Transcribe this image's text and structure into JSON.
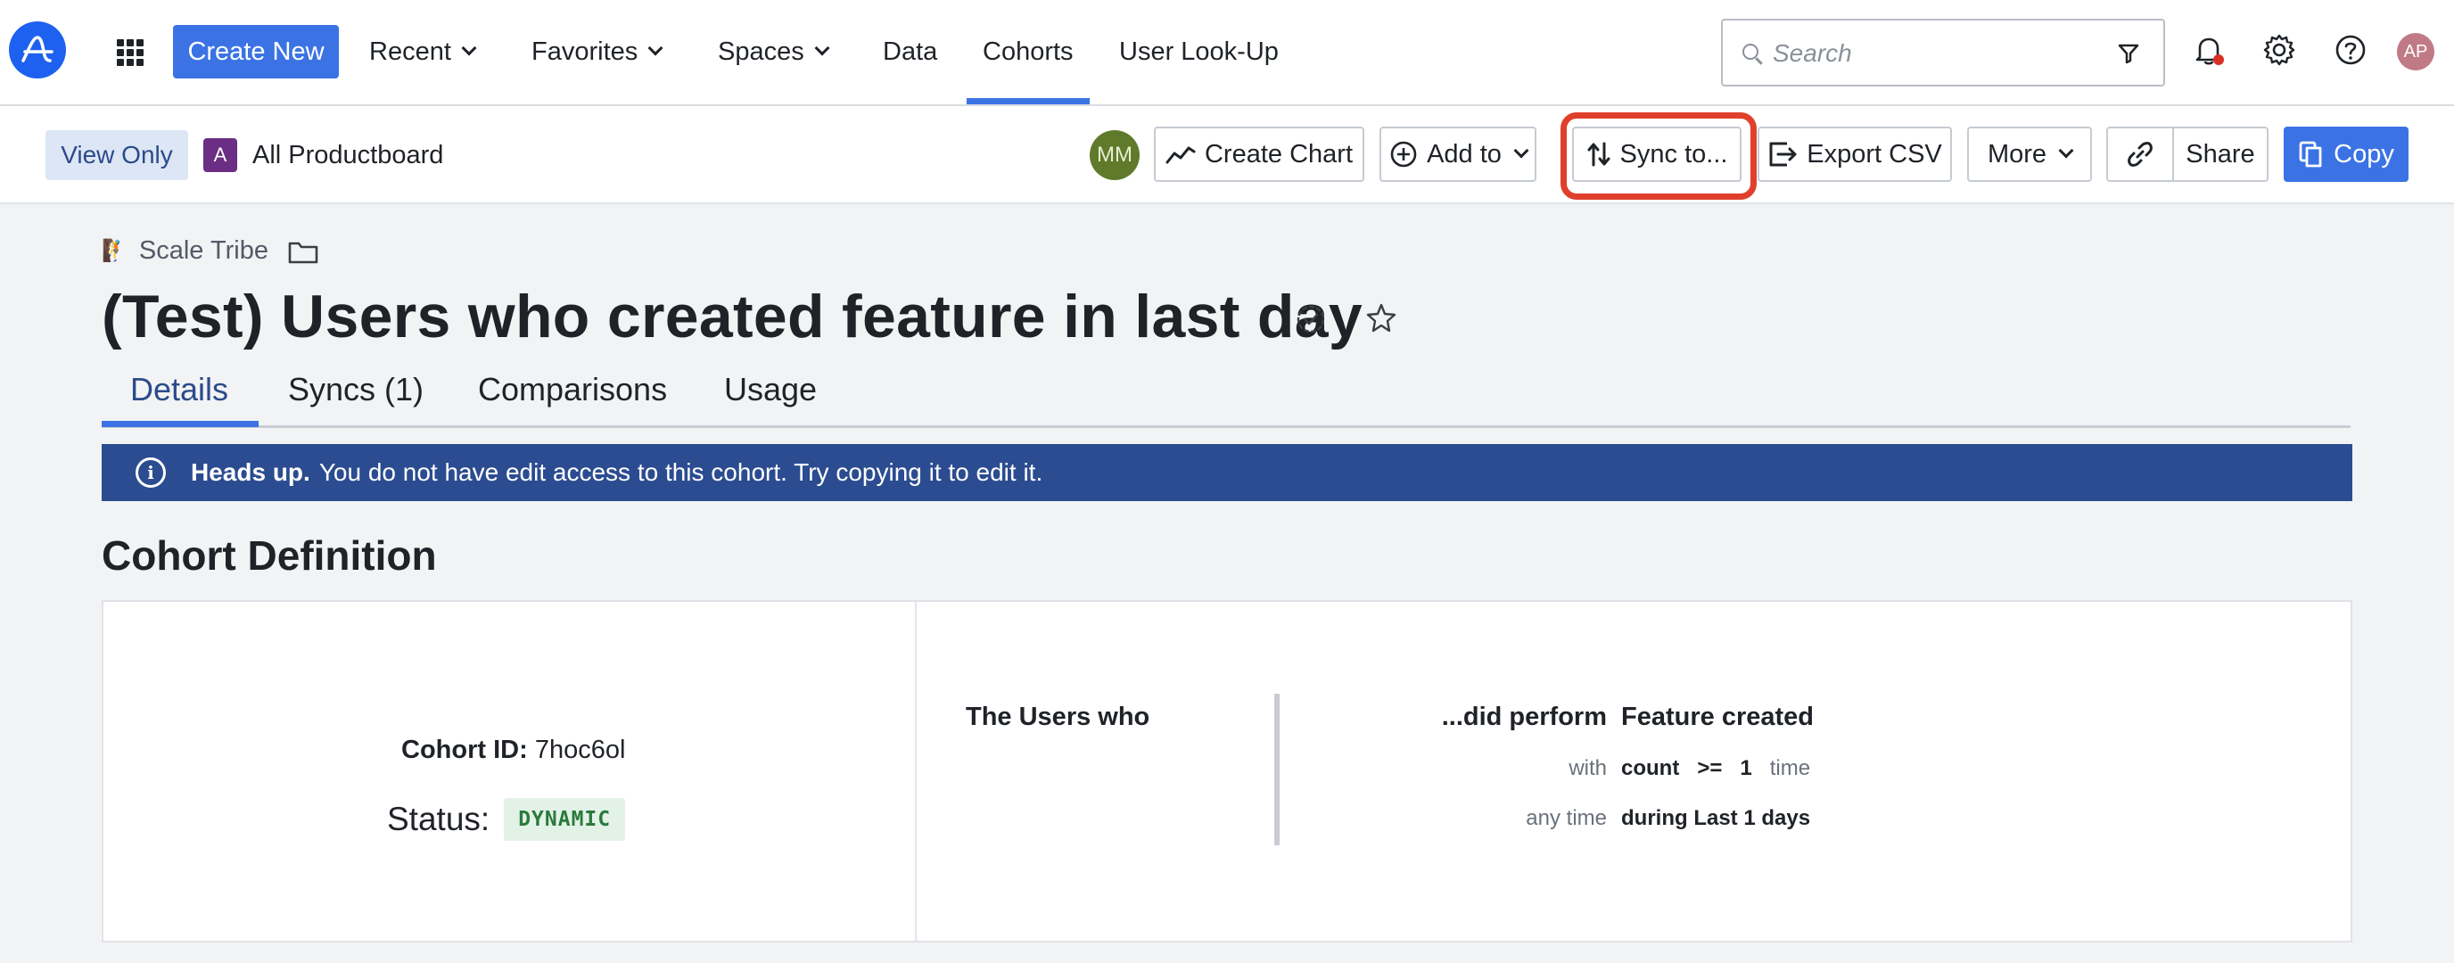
{
  "topnav": {
    "logo_icon": "amplitude-logo-icon",
    "apps_icon": "apps-grid-icon",
    "create_new": "Create New",
    "items": [
      {
        "label": "Recent",
        "dropdown": true
      },
      {
        "label": "Favorites",
        "dropdown": true
      },
      {
        "label": "Spaces",
        "dropdown": true
      },
      {
        "label": "Data",
        "dropdown": false
      },
      {
        "label": "Cohorts",
        "dropdown": false,
        "active": true
      },
      {
        "label": "User Look-Up",
        "dropdown": false
      }
    ],
    "search_placeholder": "Search",
    "avatar_initials": "AP",
    "accent_color": "#3b73e4"
  },
  "toolbar": {
    "view_only": "View Only",
    "space_badge": "A",
    "space_name": "All Productboard",
    "owner_initials": "MM",
    "create_chart": "Create Chart",
    "add_to": "Add to",
    "sync_to": "Sync to...",
    "export_csv": "Export CSV",
    "more": "More",
    "share": "Share",
    "copy": "Copy",
    "highlight_color": "#e0402b"
  },
  "page": {
    "breadcrumb_emoji": "🧗",
    "breadcrumb": "Scale Tribe",
    "title": "(Test) Users who created feature in last day",
    "tabs": [
      "Details",
      "Syncs (1)",
      "Comparisons",
      "Usage"
    ],
    "active_tab": "Details",
    "banner_bold": "Heads up.",
    "banner_text": "You do not have edit access to this cohort. Try copying it to edit it.",
    "section_title": "Cohort Definition"
  },
  "cohort": {
    "id_label": "Cohort ID:",
    "id_value": "7hoc6ol",
    "status_label": "Status:",
    "status_value": "DYNAMIC",
    "users_who": "The Users who",
    "did_perform": "...did perform",
    "event": "Feature created",
    "with_label": "with",
    "count_word": "count",
    "operator": ">=",
    "count_value": "1",
    "time_word": "time",
    "time_label": "any time",
    "during": "during Last 1 days"
  }
}
